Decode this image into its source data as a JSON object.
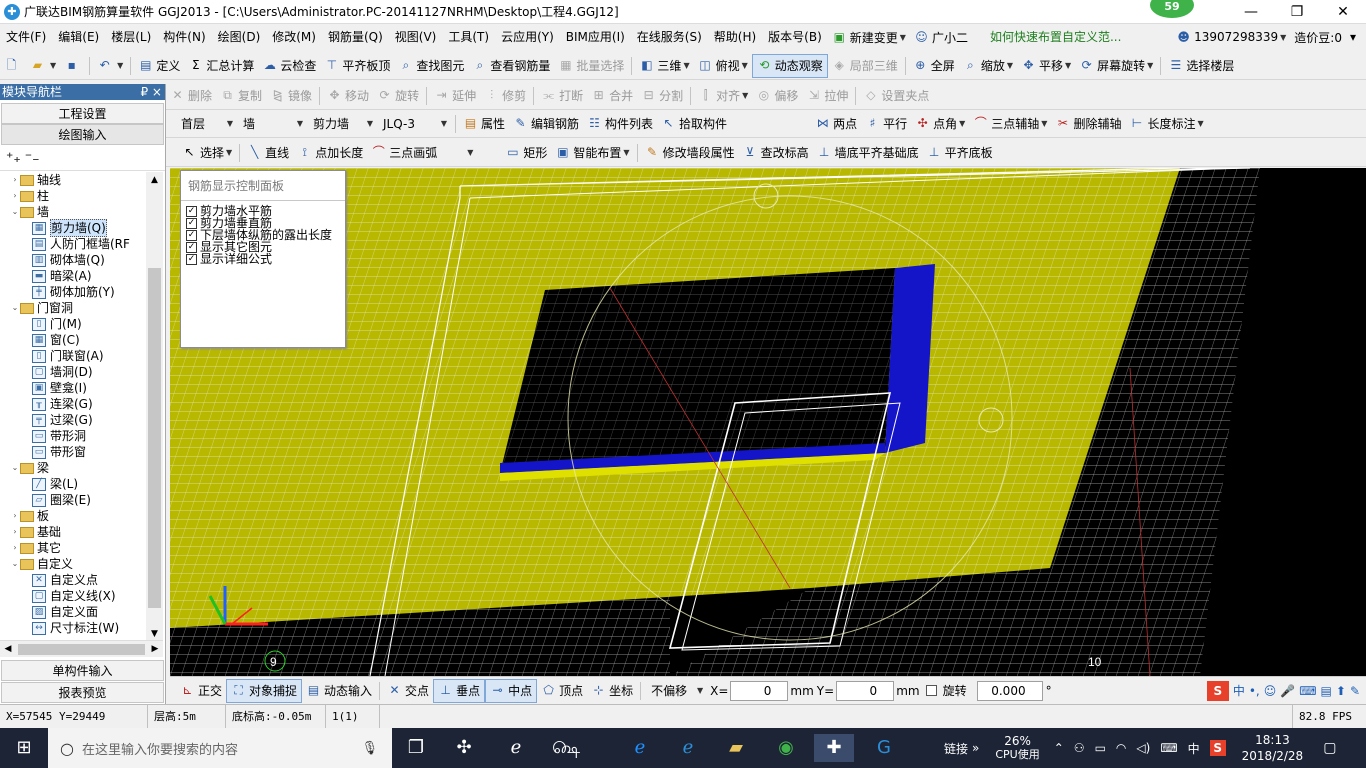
{
  "window": {
    "title": "广联达BIM钢筋算量软件 GGJ2013 - [C:\\Users\\Administrator.PC-20141127NRHM\\Desktop\\工程4.GGJ12]",
    "badge": "59"
  },
  "menu": {
    "items": [
      "文件(F)",
      "编辑(E)",
      "楼层(L)",
      "构件(N)",
      "绘图(D)",
      "修改(M)",
      "钢筋量(Q)",
      "视图(V)",
      "工具(T)",
      "云应用(Y)",
      "BIM应用(I)",
      "在线服务(S)",
      "帮助(H)",
      "版本号(B)"
    ],
    "new_change": "新建变更",
    "assistant": "广小二",
    "hint": "如何快速布置自定义范...",
    "phone": "13907298339",
    "cost_beans": "造价豆:0"
  },
  "toolbar1": {
    "items": [
      "定义",
      "汇总计算",
      "云检查",
      "平齐板顶",
      "查找图元",
      "查看钢筋量",
      "批量选择",
      "三维",
      "俯视",
      "动态观察",
      "局部三维",
      "全屏",
      "缩放",
      "平移",
      "屏幕旋转",
      "选择楼层"
    ]
  },
  "toolbar2": {
    "items": [
      "删除",
      "复制",
      "镜像",
      "移动",
      "旋转",
      "延伸",
      "修剪",
      "打断",
      "合并",
      "分割",
      "对齐",
      "偏移",
      "拉伸",
      "设置夹点"
    ]
  },
  "toolbar3": {
    "floor": "首层",
    "type": "墙",
    "subtype": "剪力墙",
    "element": "JLQ-3",
    "items": [
      "属性",
      "编辑钢筋",
      "构件列表",
      "拾取构件"
    ],
    "axis_items": [
      "两点",
      "平行",
      "点角",
      "三点辅轴",
      "删除辅轴",
      "长度标注"
    ]
  },
  "toolbar4": {
    "items": [
      "选择",
      "直线",
      "点加长度",
      "三点画弧",
      "矩形",
      "智能布置",
      "修改墙段属性",
      "查改标高",
      "墙底平齐基础底",
      "平齐底板"
    ]
  },
  "nav": {
    "header": "模块导航栏",
    "pin": "₽ ×",
    "project_settings": "工程设置",
    "drawing_input": "绘图输入",
    "tree": [
      {
        "level": 0,
        "label": "轴线",
        "expanded": false,
        "folder": true
      },
      {
        "level": 0,
        "label": "柱",
        "expanded": false,
        "folder": true
      },
      {
        "level": 0,
        "label": "墙",
        "expanded": true,
        "folder": true
      },
      {
        "level": 1,
        "label": "剪力墙(Q)",
        "selected": true,
        "glyph": "▦"
      },
      {
        "level": 1,
        "label": "人防门框墙(RF",
        "glyph": "▤"
      },
      {
        "level": 1,
        "label": "砌体墙(Q)",
        "glyph": "▥"
      },
      {
        "level": 1,
        "label": "暗梁(A)",
        "glyph": "▬"
      },
      {
        "level": 1,
        "label": "砌体加筋(Y)",
        "glyph": "╪"
      },
      {
        "level": 0,
        "label": "门窗洞",
        "expanded": true,
        "folder": true
      },
      {
        "level": 1,
        "label": "门(M)",
        "glyph": "▯"
      },
      {
        "level": 1,
        "label": "窗(C)",
        "glyph": "▦"
      },
      {
        "level": 1,
        "label": "门联窗(A)",
        "glyph": "▯"
      },
      {
        "level": 1,
        "label": "墙洞(D)",
        "glyph": "▢"
      },
      {
        "level": 1,
        "label": "壁龛(I)",
        "glyph": "▣"
      },
      {
        "level": 1,
        "label": "连梁(G)",
        "glyph": "╥"
      },
      {
        "level": 1,
        "label": "过梁(G)",
        "glyph": "╤"
      },
      {
        "level": 1,
        "label": "带形洞",
        "glyph": "▭"
      },
      {
        "level": 1,
        "label": "带形窗",
        "glyph": "▭"
      },
      {
        "level": 0,
        "label": "梁",
        "expanded": true,
        "folder": true
      },
      {
        "level": 1,
        "label": "梁(L)",
        "glyph": "╱"
      },
      {
        "level": 1,
        "label": "圈梁(E)",
        "glyph": "▱"
      },
      {
        "level": 0,
        "label": "板",
        "expanded": false,
        "folder": true
      },
      {
        "level": 0,
        "label": "基础",
        "expanded": false,
        "folder": true
      },
      {
        "level": 0,
        "label": "其它",
        "expanded": false,
        "folder": true
      },
      {
        "level": 0,
        "label": "自定义",
        "expanded": true,
        "folder": true
      },
      {
        "level": 1,
        "label": "自定义点",
        "glyph": "✕"
      },
      {
        "level": 1,
        "label": "自定义线(X)",
        "glyph": "▢"
      },
      {
        "level": 1,
        "label": "自定义面",
        "glyph": "▨"
      },
      {
        "level": 1,
        "label": "尺寸标注(W)",
        "glyph": "↔"
      }
    ],
    "single_input": "单构件输入",
    "report_preview": "报表预览"
  },
  "rebar_panel": {
    "title": "钢筋显示控制面板",
    "options": [
      "剪力墙水平筋",
      "剪力墙垂直筋",
      "下层墙体纵筋的露出长度",
      "显示其它图元",
      "显示详细公式"
    ]
  },
  "viewport": {
    "axis_labels": [
      "9",
      "10"
    ]
  },
  "snapbar": {
    "items": [
      "正交",
      "对象捕捉",
      "动态输入",
      "交点",
      "垂点",
      "中点",
      "顶点",
      "坐标"
    ],
    "offset_mode": "不偏移",
    "x_label": "X=",
    "x_value": "0",
    "y_label": "Y=",
    "y_value": "0",
    "unit": "mm",
    "rotate_label": "旋转",
    "rotate_value": "0.000",
    "deg": "°"
  },
  "statusbar": {
    "coords": "X=57545 Y=29449",
    "floor_height": "层高:5m",
    "bottom_elev": "底标高:-0.05m",
    "count": "1(1)",
    "fps": "82.8 FPS"
  },
  "taskbar": {
    "search_placeholder": "在这里输入你要搜索的内容",
    "link": "链接",
    "cpu_percent": "26%",
    "cpu_label": "CPU使用",
    "ime": "中",
    "time": "18:13",
    "date": "2018/2/28"
  },
  "colors": {
    "viewport_bg": "#000000",
    "wall": "#b8b800",
    "accent": "#2b8fd8",
    "nav_header": "#3a6ea5"
  }
}
